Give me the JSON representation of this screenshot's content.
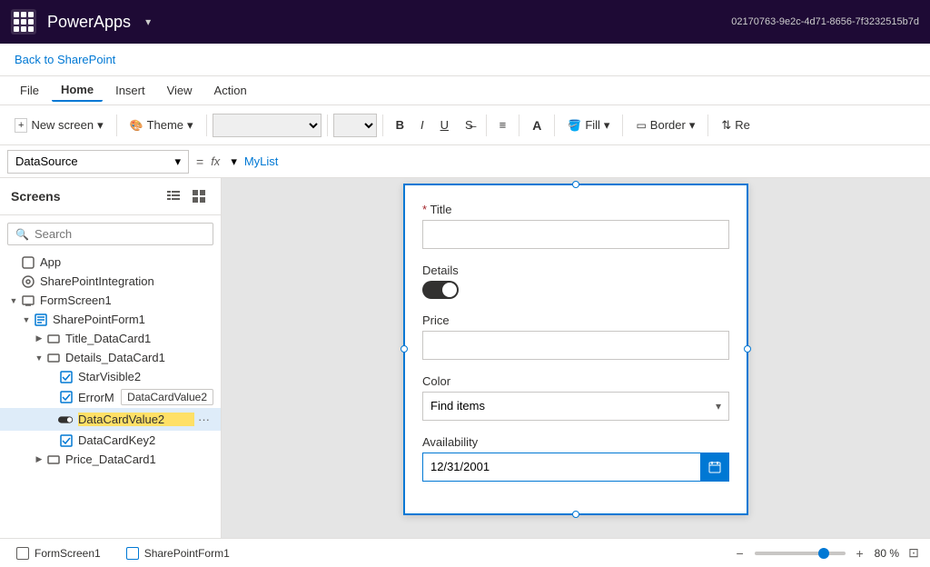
{
  "app": {
    "name": "PowerApps",
    "caret": "▾",
    "tenant_id": "02170763-9e2c-4d71-8656-7f3232515b7d"
  },
  "back_link": "Back to SharePoint",
  "menu": {
    "items": [
      "File",
      "Home",
      "Insert",
      "View",
      "Action"
    ],
    "active": "Home"
  },
  "toolbar": {
    "new_screen": "New screen",
    "new_screen_caret": "▾",
    "theme": "Theme",
    "theme_caret": "▾",
    "bold": "B",
    "italic": "I",
    "underline": "U",
    "strikethrough": "—",
    "align_left": "≡",
    "fill": "Fill",
    "border": "Border",
    "reorder": "Re"
  },
  "formula_bar": {
    "selector": "DataSource",
    "equals": "=",
    "fx": "fx",
    "value": "MyList"
  },
  "sidebar": {
    "title": "Screens",
    "search_placeholder": "Search",
    "tree": [
      {
        "id": "app",
        "label": "App",
        "indent": 0,
        "type": "app",
        "expanded": false
      },
      {
        "id": "sharepoint-integration",
        "label": "SharePointIntegration",
        "indent": 0,
        "type": "sp",
        "expanded": false
      },
      {
        "id": "formscreen1",
        "label": "FormScreen1",
        "indent": 0,
        "type": "screen",
        "expanded": true
      },
      {
        "id": "sharepointform1",
        "label": "SharePointForm1",
        "indent": 1,
        "type": "form",
        "expanded": true
      },
      {
        "id": "title-datacard1",
        "label": "Title_DataCard1",
        "indent": 2,
        "type": "datacard",
        "expanded": false
      },
      {
        "id": "details-datacard1",
        "label": "Details_DataCard1",
        "indent": 2,
        "type": "datacard",
        "expanded": true
      },
      {
        "id": "starvisible2",
        "label": "StarVisible2",
        "indent": 3,
        "type": "control"
      },
      {
        "id": "errormessage",
        "label": "ErrorM",
        "indent": 3,
        "type": "control",
        "tooltip": "DataCardValue2"
      },
      {
        "id": "datacardvalue2",
        "label": "DataCardValue2",
        "indent": 3,
        "type": "toggle",
        "selected": true
      },
      {
        "id": "datacardkey2",
        "label": "DataCardKey2",
        "indent": 3,
        "type": "control"
      },
      {
        "id": "price-datacard1",
        "label": "Price_DataCard1",
        "indent": 2,
        "type": "datacard",
        "expanded": false
      }
    ]
  },
  "form": {
    "title_label": "Title",
    "title_required": "*",
    "title_placeholder": "",
    "details_label": "Details",
    "price_label": "Price",
    "price_placeholder": "",
    "color_label": "Color",
    "color_placeholder": "Find items",
    "availability_label": "Availability",
    "availability_date": "12/31/2001"
  },
  "bottom_tabs": [
    {
      "id": "formscreen1-tab",
      "label": "FormScreen1"
    },
    {
      "id": "sharepointform1-tab",
      "label": "SharePointForm1"
    }
  ],
  "zoom": {
    "minus": "−",
    "plus": "+",
    "value": "80 %",
    "fit_icon": "⊡"
  }
}
